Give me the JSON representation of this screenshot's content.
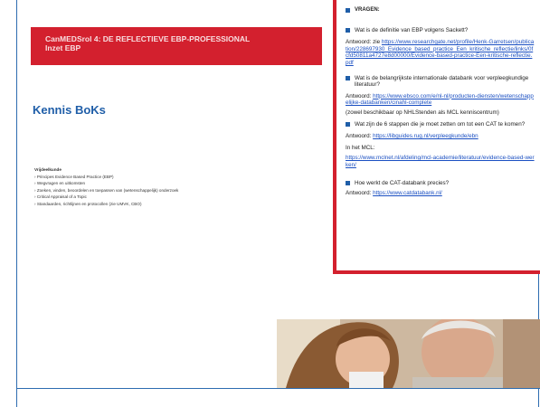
{
  "slide_left": {
    "banner_line1": "CanMEDSrol 4: DE REFLECTIEVE EBP-PROFESSIONAL",
    "banner_line2": "Inzet EBP",
    "heading": "Kennis BoKs",
    "knowledge_title": "Vrijdeelkunde",
    "knowledge_items": [
      "Principes Evidence Based Practice (EBP)",
      "Wegvragen en uitkomsten",
      "Zoeken, vinden, beoordelen en toepassen van (wetenschappelijk) onderzoek",
      "Critical Appraisal of a Topic",
      "Standaarden, richtlijnen en protocollen (zie UMVK, CBO)"
    ]
  },
  "panel": {
    "title": "VRAGEN:",
    "q1": "Wat is de definitie van EBP volgens Sackett?",
    "a1_prefix": "Antwoord: zie ",
    "a1_link": "https://www.researchgate.net/profile/Henk-Garretsen/publication/228697930_Evidence_based_practice_Een_kritische_reflectie/links/0fcfd50811a4727e8d00000/Evidence-based-practice-Een-kritische-reflectie.pdf",
    "q2": "Wat is de belangrijkste internationale databank voor verpleegkundige literatuur?",
    "a2_prefix": "Antwoord: ",
    "a2_link": "https://www.ebsco.com/e/nl-nl/producten-diensten/wetenschappelijke-databanken/cinahl-complete",
    "a2_note": "(zowel beschikbaar op NHLStenden als MCL kenniscentrum)",
    "q3": "Wat zijn de 6 stappen die je moet zetten om tot een CAT te komen?",
    "a3_prefix": "Antwoord: ",
    "a3_link": "https://libguides.rug.nl/verpleegkunde/ebn",
    "a3_mcl_label": "In het MCL:",
    "a3_mcl_link": "https://www.mclnet.nl/afdeling/mcl-academie/literatuur/evidence-based-werken/",
    "q4": "Hoe werkt de CAT-databank precies?",
    "a4_prefix": "Antwoord: ",
    "a4_link": "https://www.catdatabank.nl/"
  },
  "colors": {
    "accent_red": "#d3202e",
    "accent_blue": "#1f5ea8",
    "link": "#1a4fc2"
  }
}
